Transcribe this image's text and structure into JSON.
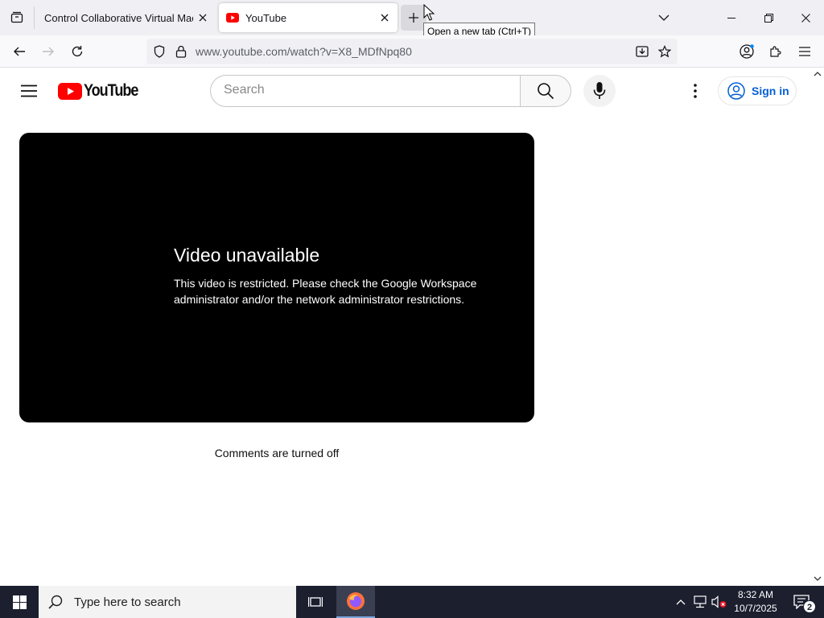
{
  "browser": {
    "tabs": [
      {
        "title": "Control Collaborative Virtual Machines",
        "active": false
      },
      {
        "title": "YouTube",
        "active": true
      }
    ],
    "new_tab_tooltip": "Open a new tab (Ctrl+T)",
    "url": "www.youtube.com/watch?v=X8_MDfNpq80"
  },
  "youtube": {
    "logo_text": "YouTube",
    "search_placeholder": "Search",
    "sign_in_label": "Sign in",
    "brand_color": "#ff0000",
    "player": {
      "error_title": "Video unavailable",
      "error_message": "This video is restricted. Please check the Google Workspace administrator and/or the network administrator restrictions."
    },
    "comments_status": "Comments are turned off"
  },
  "taskbar": {
    "search_placeholder": "Type here to search",
    "time": "8:32 AM",
    "date": "10/7/2025",
    "notification_count": "2"
  }
}
